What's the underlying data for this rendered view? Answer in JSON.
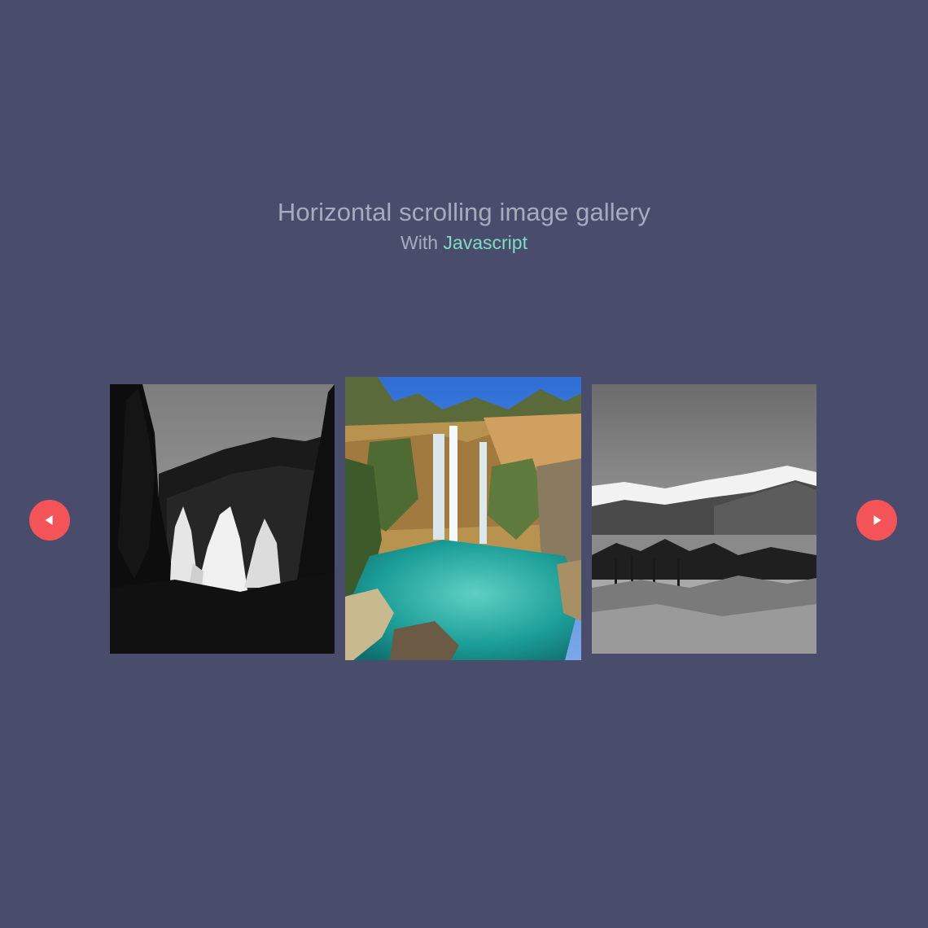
{
  "header": {
    "title": "Horizontal scrolling image gallery",
    "subtitle_prefix": "With",
    "subtitle_accent": "Javascript"
  },
  "gallery": {
    "prev_icon": "triangle-left",
    "next_icon": "triangle-right",
    "images": [
      {
        "subject": "forest-trees-black-and-white"
      },
      {
        "subject": "waterfall-turquoise-pool"
      },
      {
        "subject": "mountains-clouds-black-and-white"
      }
    ]
  },
  "colors": {
    "background": "#4a4c6b",
    "text": "#a7abbd",
    "accent": "#7fdcc4",
    "button": "#f45457"
  }
}
